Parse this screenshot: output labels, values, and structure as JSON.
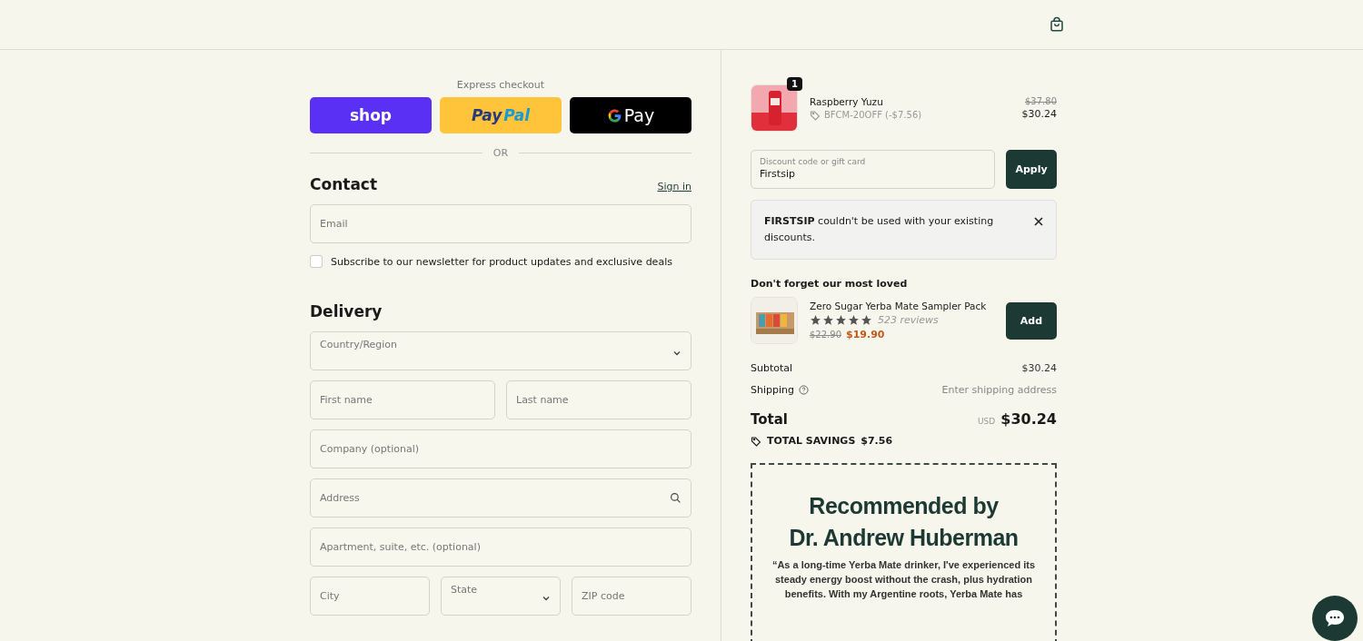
{
  "express": {
    "title": "Express checkout",
    "buttons": [
      {
        "kind": "shop",
        "label": "shop"
      },
      {
        "kind": "paypal",
        "parts": [
          "Pay",
          "Pal"
        ]
      },
      {
        "kind": "gpay",
        "label": "Pay"
      }
    ],
    "divider": "OR"
  },
  "contact": {
    "title": "Contact",
    "link": "Sign in",
    "email": {
      "placeholder": "Email"
    },
    "newsletter": {
      "label": "Subscribe to our newsletter for product updates and exclusive deals",
      "checked": false
    }
  },
  "delivery": {
    "title": "Delivery",
    "rows": [
      [
        {
          "kind": "select",
          "placeholder": "Country/Region"
        }
      ],
      [
        {
          "kind": "text",
          "placeholder": "First name"
        },
        {
          "kind": "text",
          "placeholder": "Last name"
        }
      ],
      [
        {
          "kind": "text",
          "placeholder": "Company (optional)"
        }
      ],
      [
        {
          "kind": "search",
          "placeholder": "Address"
        }
      ],
      [
        {
          "kind": "text",
          "placeholder": "Apartment, suite, etc. (optional)"
        }
      ],
      [
        {
          "kind": "text",
          "placeholder": "City"
        },
        {
          "kind": "select",
          "placeholder": "State"
        },
        {
          "kind": "text",
          "placeholder": "ZIP code"
        }
      ]
    ]
  },
  "cart": {
    "item": {
      "name": "Raspberry Yuzu",
      "quantity": "1",
      "discount": "BFCM-20OFF (-$7.56)",
      "old_price": "$37.80",
      "price": "$30.24"
    },
    "discount": {
      "label": "Discount code or gift card",
      "value": "Firstsip",
      "button": "Apply"
    },
    "alert": {
      "text": "**FIRSTSIP** couldn't be used with your existing discounts."
    },
    "upsell": {
      "title": "Don't forget our most loved",
      "name": "Zero Sugar Yerba Mate Sampler Pack",
      "stars": 5,
      "reviews": "523 reviews",
      "old_price": "$22.90",
      "price": "$19.90",
      "button": "Add"
    },
    "summary": [
      {
        "label": "Subtotal",
        "value": "$30.24",
        "kind": "plain"
      },
      {
        "label": "Shipping",
        "value": "Enter shipping address",
        "kind": "help"
      }
    ],
    "total": {
      "label": "Total",
      "currency": "USD",
      "value": "$30.24"
    },
    "savings": {
      "label": "TOTAL SAVINGS",
      "value": "$7.56"
    },
    "promo": {
      "title_lines": [
        "Recommended by",
        "Dr. Andrew Huberman"
      ],
      "quote": "“As a long-time Yerba Mate drinker, I've experienced its steady energy boost without the crash, plus hydration benefits. With my Argentine roots, Yerba Mate has"
    }
  }
}
